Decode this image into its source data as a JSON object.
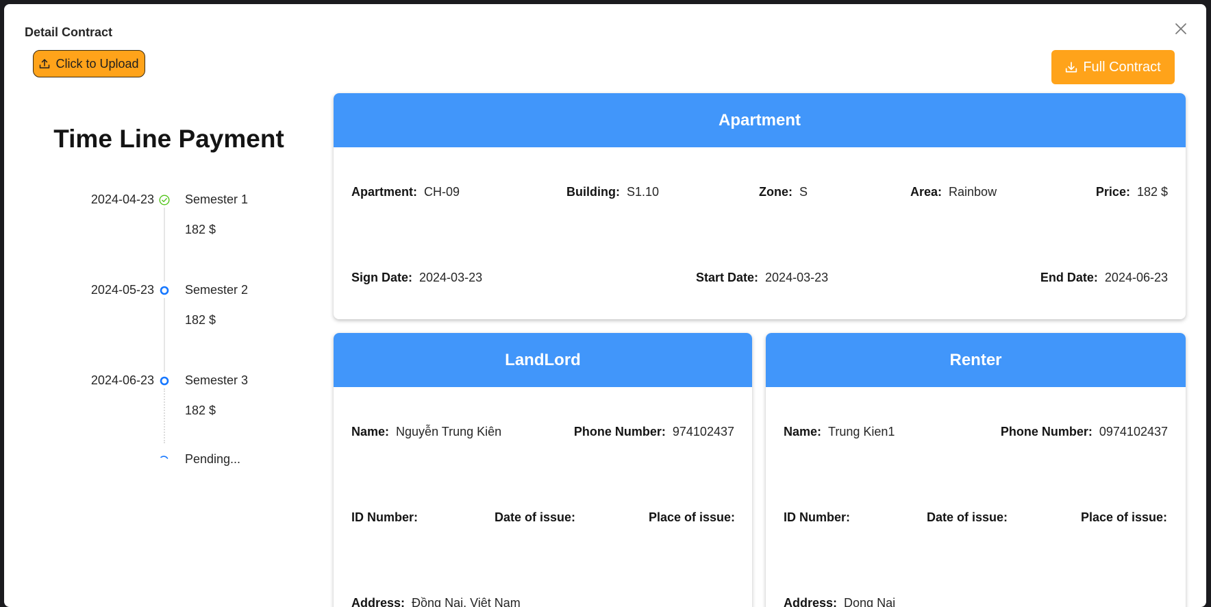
{
  "modal": {
    "title": "Detail Contract",
    "upload_label": "Click to Upload",
    "full_contract_label": "Full Contract"
  },
  "colors": {
    "accent_orange": "#ffa31a",
    "header_blue": "#4196fa",
    "done_green": "#52c41a",
    "active_blue": "#1677ff"
  },
  "timeline": {
    "title": "Time Line Payment",
    "items": [
      {
        "date": "2024-04-23",
        "label": "Semester 1",
        "amount": "182 $",
        "status": "done"
      },
      {
        "date": "2024-05-23",
        "label": "Semester 2",
        "amount": "182 $",
        "status": "upcoming"
      },
      {
        "date": "2024-06-23",
        "label": "Semester 3",
        "amount": "182 $",
        "status": "upcoming"
      }
    ],
    "pending_label": "Pending..."
  },
  "apartment": {
    "title": "Apartment",
    "apartment_label": "Apartment:",
    "apartment_value": "CH-09",
    "building_label": "Building:",
    "building_value": "S1.10",
    "zone_label": "Zone:",
    "zone_value": "S",
    "area_label": "Area:",
    "area_value": "Rainbow",
    "price_label": "Price:",
    "price_value": "182 $",
    "sign_label": "Sign Date:",
    "sign_value": "2024-03-23",
    "start_label": "Start Date:",
    "start_value": "2024-03-23",
    "end_label": "End Date:",
    "end_value": "2024-06-23"
  },
  "landlord": {
    "title": "LandLord",
    "name_label": "Name:",
    "name_value": "Nguyễn Trung Kiên",
    "phone_label": "Phone Number:",
    "phone_value": "974102437",
    "id_label": "ID Number:",
    "issue_date_label": "Date of issue:",
    "issue_place_label": "Place of issue:",
    "address_label": "Address:",
    "address_value": "Đồng Nai, Việt Nam"
  },
  "renter": {
    "title": "Renter",
    "name_label": "Name:",
    "name_value": "Trung Kien1",
    "phone_label": "Phone Number:",
    "phone_value": "0974102437",
    "id_label": "ID Number:",
    "issue_date_label": "Date of issue:",
    "issue_place_label": "Place of issue:",
    "address_label": "Address:",
    "address_value": "Dong Nai"
  }
}
